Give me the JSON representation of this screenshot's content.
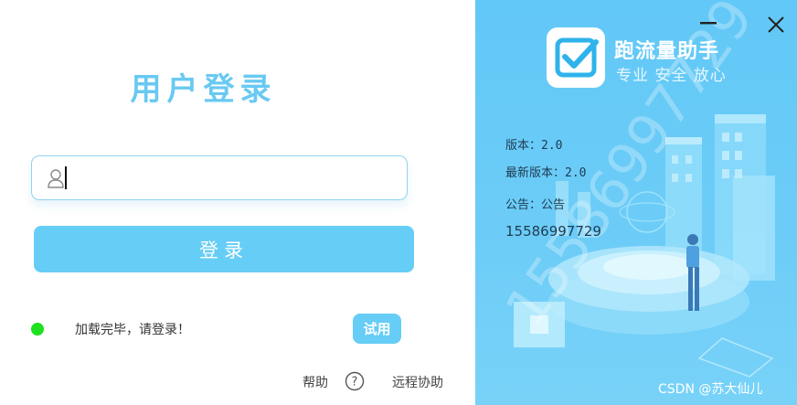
{
  "login": {
    "title": "用户登录",
    "username_value": "",
    "login_button": "登录",
    "status_text": "加载完毕，请登录！",
    "trial_button": "试用",
    "help_label": "帮助",
    "remote_assist_label": "远程协助"
  },
  "side": {
    "app_name": "跑流量助手",
    "slogan": "专业 安全 放心",
    "version": "版本：2.0",
    "latest_version": "最新版本：2.0",
    "notice": "公告：公告",
    "phone": "15586997729",
    "watermark_digits": "15586997729",
    "credit": "CSDN @苏大仙儿"
  },
  "colors": {
    "accent": "#66cdf6",
    "title": "#69c9f2",
    "status_ok": "#1ee01e",
    "panel_bg": "#62c8f7"
  },
  "icons": [
    "user-icon",
    "status-indicator-icon",
    "help-icon",
    "minimize-icon",
    "close-icon",
    "app-logo-checkbox-icon"
  ]
}
